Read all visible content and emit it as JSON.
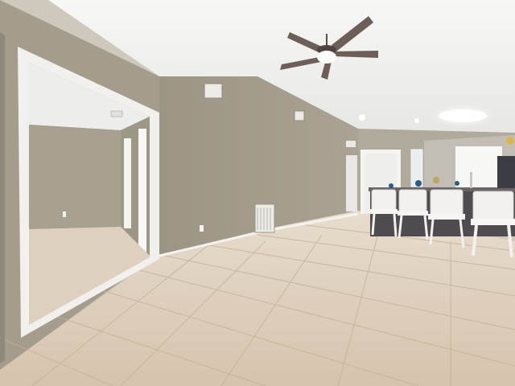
{
  "scene": {
    "subject": "empty-interior-room",
    "features": [
      "vaulted-ceiling",
      "ceiling-fan",
      "tile-floor",
      "open-doorway",
      "kitchen-bar",
      "bar-stools"
    ],
    "colors": {
      "wall": "#a39c8d",
      "wall_shadow": "#8f887a",
      "ceiling": "#efefec",
      "floor": "#d8c7b3",
      "floor_grout": "#bda992",
      "trim": "#f4f2ee",
      "fan_blade": "#6d5f58",
      "counter": "#4f4b4e",
      "stool": "#f3f1ef"
    },
    "stool_count": 4
  }
}
